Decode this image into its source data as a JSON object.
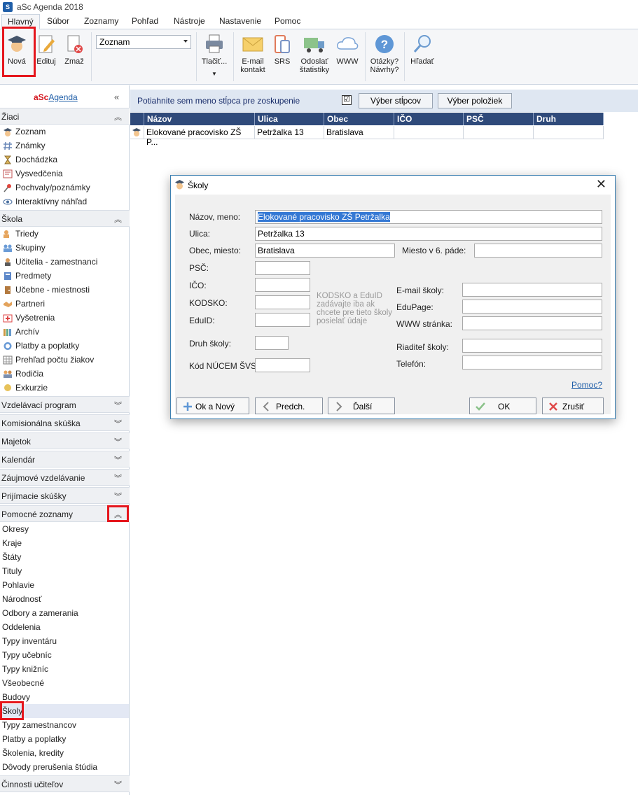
{
  "window": {
    "title": "aSc Agenda 2018"
  },
  "menu": [
    "Hlavný",
    "Súbor",
    "Zoznamy",
    "Pohľad",
    "Nástroje",
    "Nastavenie",
    "Pomoc"
  ],
  "ribbon": {
    "nova": "Nová",
    "edituj": "Edituj",
    "zmaz": "Zmaž",
    "combo": "Zoznam",
    "tlacit": "Tlačiť...",
    "email1": "E-mail",
    "email2": "kontakt",
    "srs": "SRS",
    "odoslat1": "Odoslať",
    "odoslat2": "štatistiky",
    "www": "WWW",
    "otazky1": "Otázky?",
    "otazky2": "Návrhy?",
    "hladat": "Hľadať"
  },
  "sidebar": {
    "logo_red": "aSc",
    "logo_blue": "Agenda",
    "collapse": "«",
    "sections": {
      "ziaci": "Žiaci",
      "skola": "Škola",
      "vzdel": "Vzdelávací program",
      "komis": "Komisionálna skúška",
      "majetok": "Majetok",
      "kalendar": "Kalendár",
      "zaujm": "Záujmové vzdelávanie",
      "prij": "Prijímacie skúšky",
      "pomoc": "Pomocné zoznamy",
      "cinn": "Činnosti učiteľov"
    },
    "ziaci_items": [
      "Zoznam",
      "Známky",
      "Dochádzka",
      "Vysvedčenia",
      "Pochvaly/poznámky",
      "Interaktívny náhľad"
    ],
    "skola_items": [
      "Triedy",
      "Skupiny",
      "Učitelia - zamestnanci",
      "Predmety",
      "Učebne - miestnosti",
      "Partneri",
      "Vyšetrenia",
      "Archív",
      "Platby a poplatky",
      "Prehľad počtu žiakov",
      "Rodičia",
      "Exkurzie"
    ],
    "pomoc_items": [
      "Okresy",
      "Kraje",
      "Štáty",
      "Tituly",
      "Pohlavie",
      "Národnosť",
      "Odbory a zamerania",
      "Oddelenia",
      "Typy inventáru",
      "Typy učebníc",
      "Typy knižníc",
      "Všeobecné",
      "Budovy",
      "Školy",
      "Typy zamestnancov",
      "Platby a poplatky",
      "Školenia, kredity",
      "Dôvody prerušenia štúdia"
    ]
  },
  "main": {
    "group_hint": "Potiahnite sem meno stĺpca pre zoskupenie",
    "check": "☑",
    "btn_columns": "Výber stĺpcov",
    "btn_items": "Výber položiek",
    "columns": [
      "Názov",
      "Ulica",
      "Obec",
      "IČO",
      "PSČ",
      "Druh"
    ],
    "row": [
      "Elokované pracovisko ZŠ P...",
      "Petržalka 13",
      "Bratislava",
      "",
      "",
      ""
    ]
  },
  "dialog": {
    "title": "Školy",
    "close": "✕",
    "labels": {
      "nazov": "Názov, meno:",
      "ulica": "Ulica:",
      "obec": "Obec, miesto:",
      "miesto6": "Miesto v 6. páde:",
      "psc": "PSČ:",
      "ico": "IČO:",
      "kodsko": "KODSKO:",
      "eduid": "EduID:",
      "druh": "Druh školy:",
      "kod": "Kód NÚCEM ŠVS:",
      "email": "E-mail školy:",
      "edupage": "EduPage:",
      "www": "WWW stránka:",
      "riaditel": "Riaditeľ školy:",
      "telefon": "Telefón:"
    },
    "values": {
      "nazov": "Elokované pracovisko ZŠ Petržalka",
      "ulica": "Petržalka 13",
      "obec": "Bratislava"
    },
    "hint": "KODSKO a EduID zadávajte iba ak chcete pre tieto školy posielať údaje",
    "help_link": "Pomoc?",
    "buttons": {
      "ok_new": "Ok a Nový",
      "prev": "Predch.",
      "next": "Ďalší",
      "ok": "OK",
      "cancel": "Zrušiť"
    }
  }
}
